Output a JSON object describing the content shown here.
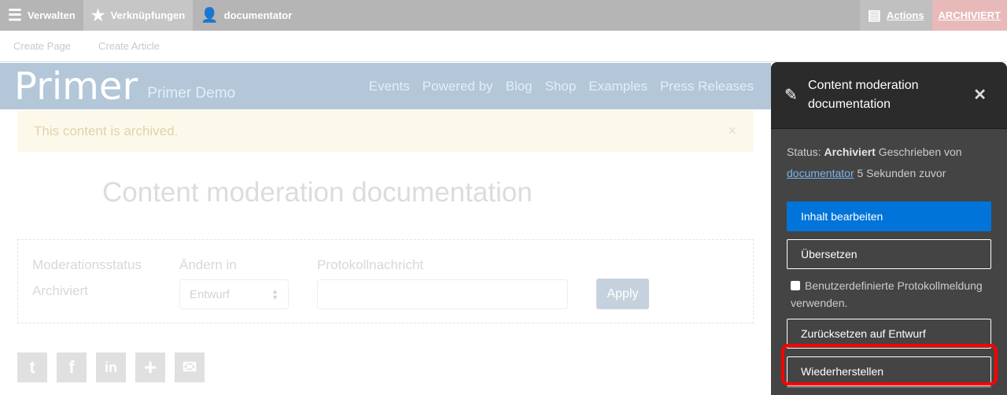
{
  "toolbar": {
    "manage": "Verwalten",
    "shortcuts": "Verknüpfungen",
    "user": "documentator",
    "actions": "Actions",
    "state": "ARCHIVIERT"
  },
  "subbar": {
    "create_page": "Create Page",
    "create_article": "Create Article"
  },
  "header": {
    "logo": "Primer",
    "slogan": "Primer Demo",
    "nav": [
      "Events",
      "Powered by",
      "Blog",
      "Shop",
      "Examples",
      "Press Releases"
    ]
  },
  "alert": {
    "text": "This content is archived.",
    "close": "×"
  },
  "page_title": "Content moderation documentation",
  "moderation": {
    "status_label": "Moderationsstatus",
    "status_value": "Archiviert",
    "change_label": "Ändern in",
    "change_value": "Entwurf",
    "log_label": "Protokollnachricht",
    "log_value": "",
    "apply": "Apply"
  },
  "social": [
    "twitter-icon",
    "facebook-icon",
    "linkedin-icon",
    "plus-icon",
    "email-icon"
  ],
  "panel": {
    "title": "Content moderation documentation",
    "status_prefix": "Status:",
    "status": "Archiviert",
    "written_by": "Geschrieben von",
    "author": "documentator",
    "time": "5 Sekunden zuvor",
    "edit": "Inhalt bearbeiten",
    "translate": "Übersetzen",
    "custom_log": "Benutzerdefinierte Protokollmeldung verwenden.",
    "revert": "Zurücksetzen auf Entwurf",
    "restore": "Wiederherstellen"
  },
  "colors": {
    "primary": "#0074d9",
    "highlight": "#ff0000",
    "archived": "#e8b9b9"
  }
}
